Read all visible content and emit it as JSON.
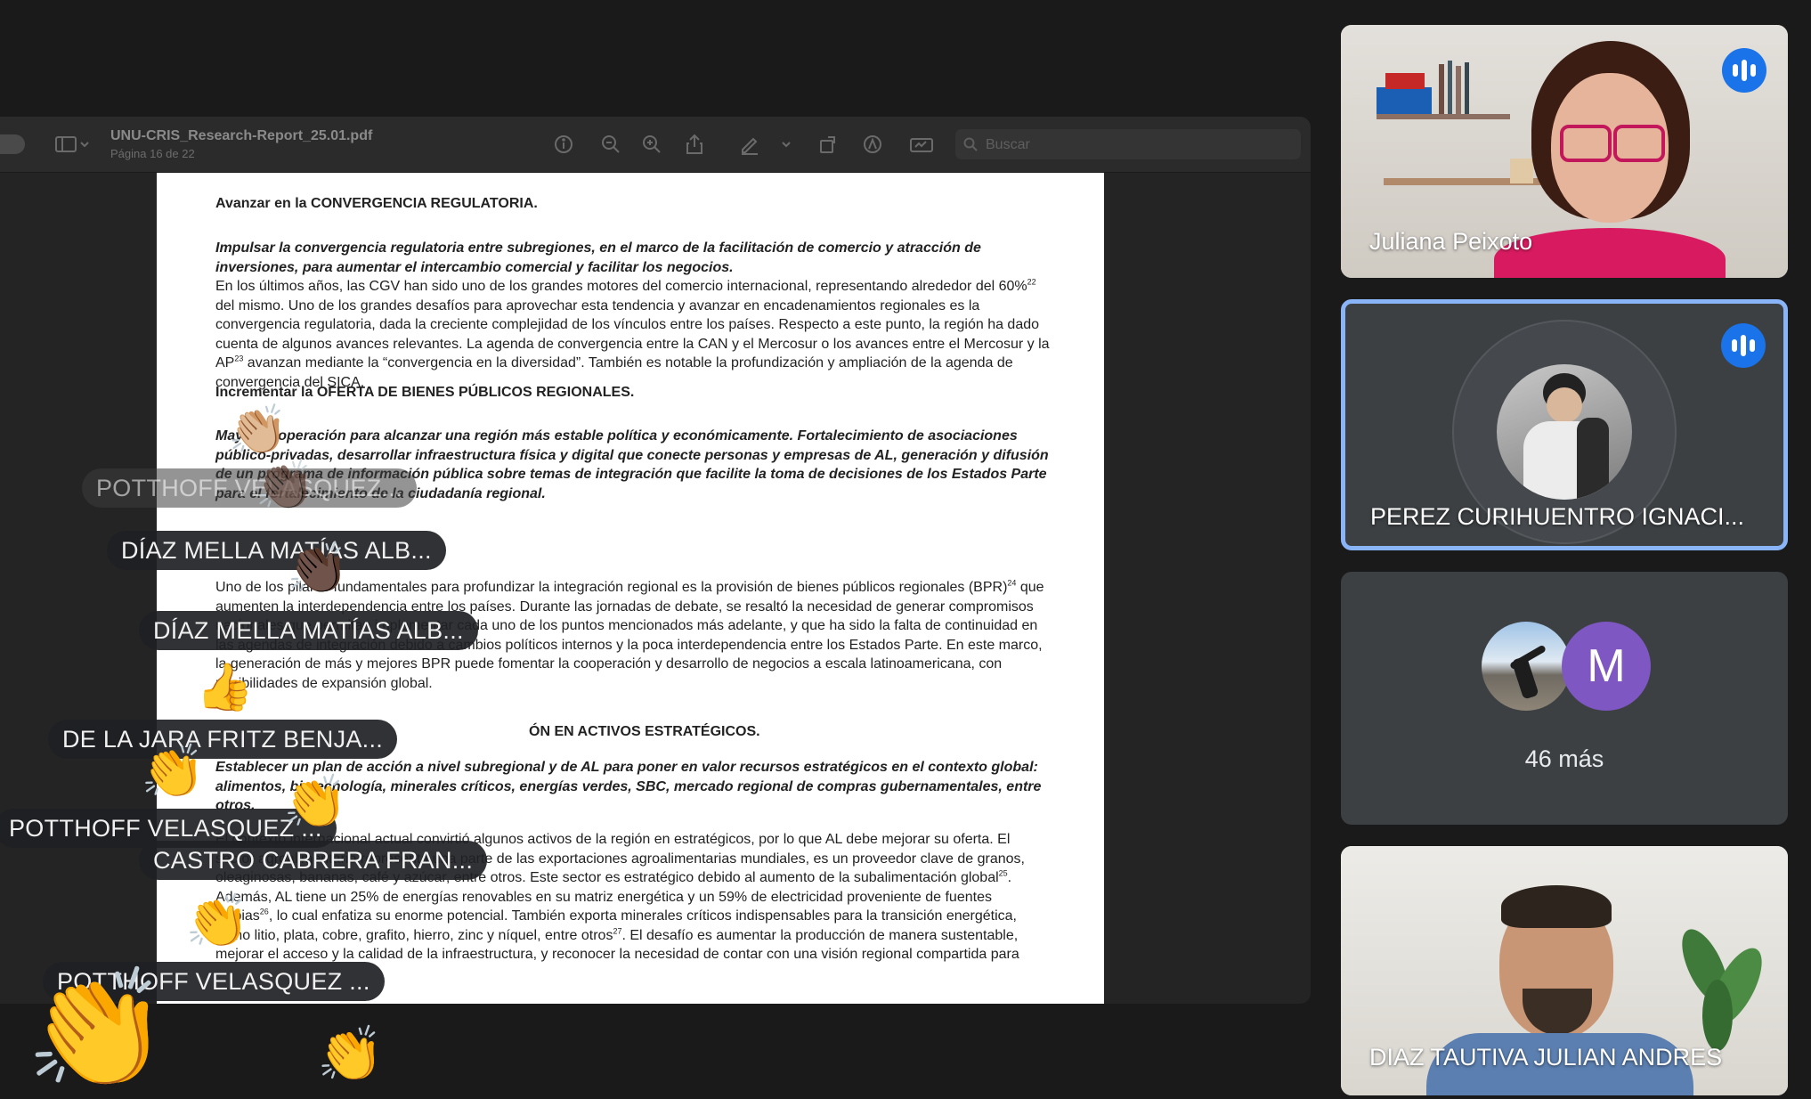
{
  "viewer": {
    "doc_title": "UNU-CRIS_Research-Report_25.01.pdf",
    "doc_subtitle": "Página 16 de 22",
    "search_placeholder": "Buscar"
  },
  "document": {
    "h1": "Avanzar en la CONVERGENCIA REGULATORIA.",
    "p1_italic": "Impulsar la convergencia regulatoria entre subregiones, en el marco de la facilitación de comercio y atracción de inversiones, para aumentar el intercambio comercial y facilitar los negocios.",
    "p1_a": "En los últimos años, las CGV han sido uno de los grandes motores del comercio internacional, representando alrededor del 60%",
    "p1_sup": "22",
    "p1_b": " del mismo. Uno de los grandes desafíos para aprovechar esta tendencia y avanzar en encadenamientos regionales es la convergencia regulatoria, dada la creciente complejidad de los vínculos entre los países. Respecto a este punto, la región ha dado cuenta de algunos avances relevantes. La agenda de convergencia entre la CAN y el Mercosur o los avances entre el Mercosur y la AP",
    "p1_sup2": "23",
    "p1_c": " avanzan mediante la “convergencia en la diversidad”. También es notable la profundización y ampliación de la agenda de convergencia del SICA.",
    "h2": "Incrementar la OFERTA DE BIENES PÚBLICOS REGIONALES.",
    "p2_italic": "Mayor cooperación para alcanzar una región más estable política y económicamente. Fortalecimiento de asociaciones público-privadas, desarrollar infraestructura física y digital que conecte personas y empresas de AL, generación y difusión de un programa de información pública sobre temas de integración que facilite la toma de decisiones de los Estados Parte para el fortalecimiento de la ciudadanía regional.",
    "p2_a": "Uno de los pilares fundamentales para profundizar la integración regional es la provisión de bienes públicos regionales (BPR)",
    "p2_sup": "24",
    "p2_b": " que aumenten la interdependencia entre los países. Durante las jornadas de debate, se resaltó la necesidad de generar compromisos nacionales que permitan implementar cada uno de los puntos mencionados más adelante, y que ha sido la falta de continuidad en las agendas de integración debido a cambios políticos internos y la poca interdependencia entre los Estados Parte. En este marco, la generación de más y mejores BPR puede fomentar la cooperación y desarrollo de negocios a escala latinoamericana, con posibilidades de expansión global.",
    "h3": "ÓN EN ACTIVOS ESTRATÉGICOS.",
    "p3_italic": "Establecer un plan de acción a nivel subregional y de AL para poner en valor recursos estratégicos en el contexto global: alimentos, biotecnología, minerales críticos, energías verdes, SBC, mercado regional de compras gubernamentales, entre otros.",
    "p3_a": "El contexto internacional actual convirtió algunos activos de la región en estratégicos, por lo que AL debe mejorar su oferta. El sector agroalimentario representa una parte de las exportaciones agroalimentarias mundiales, es un proveedor clave de granos, oleaginosas, bananas, café y azúcar, entre otros. Este sector es estratégico debido al aumento de la subalimentación global",
    "p3_sup": "25",
    "p3_b": ". Además, AL tiene un 25% de energías renovables en su matriz energética y un 59% de electricidad proveniente de fuentes limpias",
    "p3_sup2": "26",
    "p3_c": ", lo cual enfatiza su enorme potencial. También exporta minerales críticos indispensables para la transición energética, como litio, plata, cobre, grafito, hierro, zinc y níquel, entre otros",
    "p3_sup3": "27",
    "p3_d": ". El desafío es aumentar la producción de manera sustentable, mejorar el acceso y la calidad de la infraestructura, y reconocer la necesidad de contar con una visión regional compartida para"
  },
  "reactions": {
    "chips": [
      "POTTHOFF VELASQUEZ...",
      "DÍAZ MELLA MATÍAS ALB...",
      "DÍAZ MELLA MATÍAS ALB...",
      "DE LA JARA FRITZ BENJA...",
      "POTTHOFF VELASQUEZ ...",
      "CASTRO CABRERA FRAN...",
      "POTTHOFF VELASQUEZ ..."
    ],
    "emoji": {
      "clap_light": "👏🏼",
      "clap_dark": "👏🏿",
      "clap": "👏",
      "thumbs_up": "👍"
    }
  },
  "participants": {
    "juliana": "Juliana Peixoto",
    "perez": "PEREZ CURIHUENTRO IGNACI...",
    "more_avatar_letter": "M",
    "more_count": "46 más",
    "diaz": "DIAZ TAUTIVA JULIAN ANDRES"
  },
  "colors": {
    "speaking_badge": "#1a73e8",
    "active_border": "#8ab4f8",
    "avatar_m": "#7e57c2"
  }
}
